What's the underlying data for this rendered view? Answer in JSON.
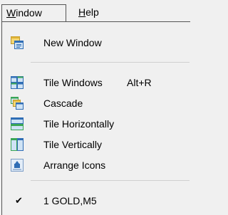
{
  "menubar": {
    "window_mnemonic": "W",
    "window_rest": "indow",
    "help_mnemonic": "H",
    "help_rest": "elp"
  },
  "menu": {
    "new_window": {
      "label": "New Window",
      "icon": "new-window-icon"
    },
    "tile_windows": {
      "label": "Tile Windows",
      "shortcut": "Alt+R",
      "icon": "tile-windows-icon"
    },
    "cascade": {
      "label": "Cascade",
      "icon": "cascade-icon"
    },
    "tile_horizontally": {
      "label": "Tile Horizontally",
      "icon": "tile-horizontally-icon"
    },
    "tile_vertically": {
      "label": "Tile Vertically",
      "icon": "tile-vertically-icon"
    },
    "arrange_icons": {
      "label": "Arrange Icons",
      "icon": "arrange-icons-icon"
    },
    "open_chart": {
      "label": "1 GOLD,M5",
      "checked": true,
      "check_glyph": "✔"
    }
  },
  "colors": {
    "menu_bg": "#f0f0f0",
    "icon_blue": "#2f6db5",
    "icon_green": "#3aa655",
    "icon_yellow": "#e8c340"
  }
}
